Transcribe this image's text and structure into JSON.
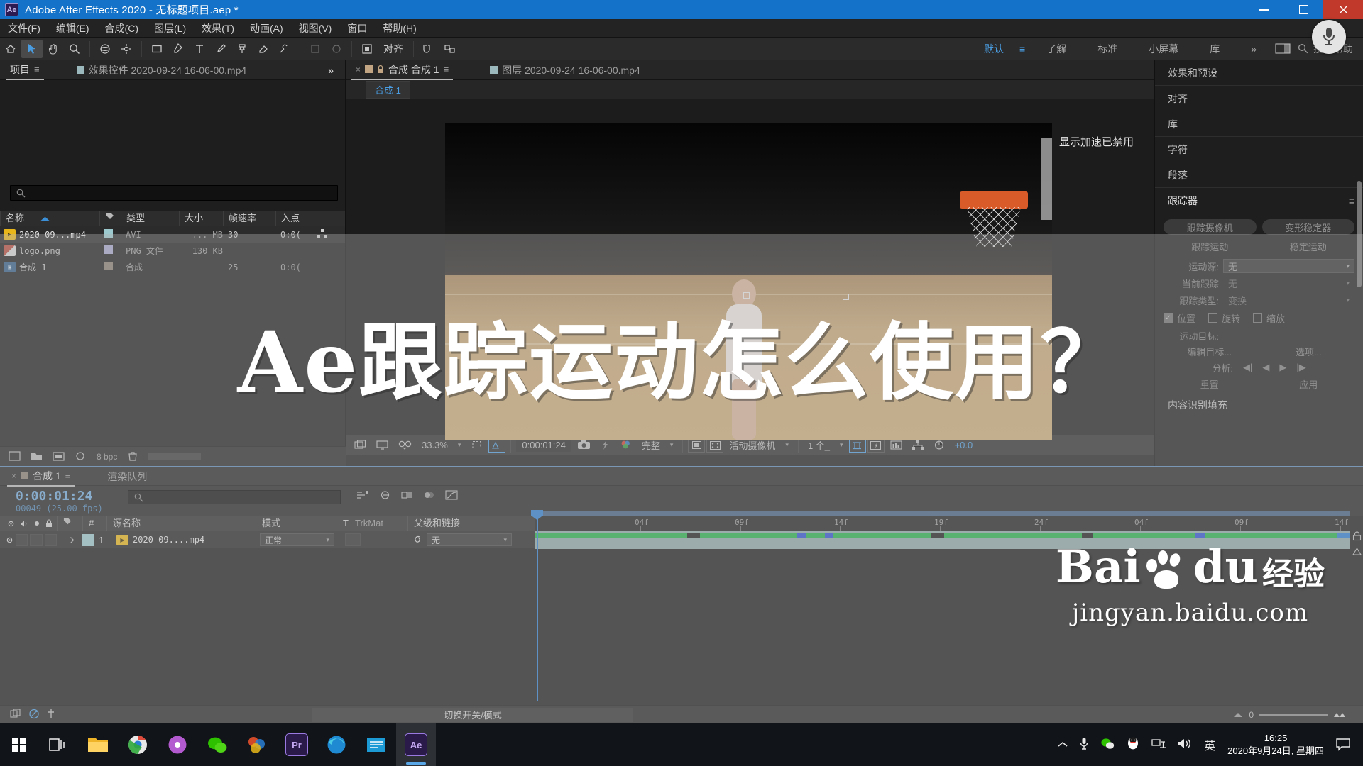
{
  "titlebar": {
    "app_badge": "Ae",
    "title": "Adobe After Effects 2020 - 无标题项目.aep *",
    "minimize": "minimize-icon",
    "maximize": "maximize-icon",
    "close": "close-icon"
  },
  "menubar": {
    "items": [
      {
        "label": "文件(F)"
      },
      {
        "label": "编辑(E)"
      },
      {
        "label": "合成(C)"
      },
      {
        "label": "图层(L)"
      },
      {
        "label": "效果(T)"
      },
      {
        "label": "动画(A)"
      },
      {
        "label": "视图(V)"
      },
      {
        "label": "窗口"
      },
      {
        "label": "帮助(H)"
      }
    ]
  },
  "toolbar": {
    "align_label": "对齐",
    "workspaces": [
      {
        "label": "默认",
        "active": true
      },
      {
        "label": "了解",
        "active": false
      },
      {
        "label": "标准",
        "active": false
      },
      {
        "label": "小屏幕",
        "active": false
      },
      {
        "label": "库",
        "active": false
      }
    ],
    "overflow": "»",
    "search_placeholder": "搜索帮助",
    "search_icon": "search-icon"
  },
  "project_panel": {
    "tabs": [
      {
        "label": "项目",
        "active": true,
        "menu": "≡"
      },
      {
        "label": "效果控件 2020-09-24 16-06-00.mp4",
        "active": false
      }
    ],
    "overflow": "»",
    "search_placeholder": "",
    "columns": [
      "名称",
      "类型",
      "大小",
      "帧速率",
      "入点"
    ],
    "sort_column": "名称",
    "rows": [
      {
        "name": "2020-09...mp4",
        "type": "AVI",
        "size": "... MB",
        "fps": "30",
        "in": "0:0(",
        "icon": "video-file-icon"
      },
      {
        "name": "logo.png",
        "type": "PNG 文件",
        "size": "130 KB",
        "fps": "",
        "in": "",
        "icon": "image-file-icon"
      },
      {
        "name": "合成 1",
        "type": "合成",
        "size": "",
        "fps": "25",
        "in": "0:0(",
        "icon": "composition-icon"
      }
    ]
  },
  "comp_panel": {
    "tabs": [
      {
        "label": "合成 合成 1",
        "active": true
      },
      {
        "label": "图层 2020-09-24 16-06-00.mp4",
        "active": false
      }
    ],
    "breadcrumb": "合成 1",
    "accel_notice": "显示加速已禁用",
    "footer": {
      "zoom": "33.3%",
      "timecode": "0:00:01:24",
      "resolution": "完整",
      "camera": "活动摄像机",
      "views": "1 个_",
      "exposure": "+0.0"
    }
  },
  "right_panel": {
    "rows": [
      {
        "label": "效果和预设"
      },
      {
        "label": "对齐"
      },
      {
        "label": "库"
      },
      {
        "label": "字符"
      },
      {
        "label": "段落"
      }
    ],
    "tracker": {
      "title": "跟踪器",
      "menu": "≡",
      "buttons": [
        {
          "label": "跟踪摄像机"
        },
        {
          "label": "变形稳定器"
        }
      ],
      "buttons2": [
        {
          "label": "跟踪运动"
        },
        {
          "label": "稳定运动"
        }
      ],
      "motion_source_label": "运动源:",
      "motion_source_value": "无",
      "current_track_label": "当前跟踪",
      "current_track_value": "无",
      "track_type_label": "跟踪类型:",
      "track_type_value": "变换",
      "checkboxes": [
        {
          "label": "位置",
          "checked": true
        },
        {
          "label": "旋转",
          "checked": false
        },
        {
          "label": "缩放",
          "checked": false
        }
      ],
      "motion_target_label": "运动目标:",
      "edit_target_label": "编辑目标...",
      "options_label": "选项...",
      "analyze_label": "分析:",
      "reset_label": "重置",
      "apply_label": "应用"
    },
    "footer_row": "内容识别填充"
  },
  "timeline": {
    "tabs": [
      {
        "label": "合成 1",
        "active": true
      },
      {
        "label": "渲染队列",
        "active": false
      }
    ],
    "timecode": "0:00:01:24",
    "frame_info": "00049 (25.00 fps)",
    "search_placeholder": "",
    "columns": [
      "#",
      "源名称",
      "模式",
      "T",
      "TrkMat",
      "父级和链接"
    ],
    "layers": [
      {
        "index": "1",
        "source_name": "2020-09....mp4",
        "mode": "正常",
        "trkmat": "",
        "parent": "无"
      }
    ],
    "ruler_ticks": [
      "04f",
      "09f",
      "14f",
      "19f",
      "24f",
      "04f",
      "09f",
      "14f"
    ],
    "status": {
      "toggle_label": "切换开关/模式",
      "zoom_value": "0"
    }
  },
  "overlay": {
    "title": "Ae跟踪运动怎么使用？",
    "watermark_brand": "Bai",
    "watermark_brand2": "du",
    "watermark_exp": "经验",
    "watermark_url": "jingyan.baidu.com"
  },
  "taskbar": {
    "start": "windows-start-icon",
    "apps": [
      {
        "name": "task-view-icon",
        "glyph": "⧉",
        "color": "#1b1f24",
        "active": false
      },
      {
        "name": "file-explorer-icon",
        "glyph": "📁",
        "color": "#f0b429",
        "active": false
      },
      {
        "name": "chrome-icon",
        "glyph": "◎",
        "color": "#e8e8e8",
        "active": false
      },
      {
        "name": "media-player-icon",
        "glyph": "◉",
        "color": "#b45ad0",
        "active": false
      },
      {
        "name": "wechat-icon",
        "glyph": "◍",
        "color": "#2dc100",
        "active": false
      },
      {
        "name": "photoshop-elements-icon",
        "glyph": "◈",
        "color": "#d04a2a",
        "active": false
      },
      {
        "name": "premiere-pro-icon",
        "glyph": "Pr",
        "color": "#2a1a4a",
        "active": false
      },
      {
        "name": "edge-icon",
        "glyph": "◐",
        "color": "#1f8ad2",
        "active": false
      },
      {
        "name": "text-editor-icon",
        "glyph": "▤",
        "color": "#1b9ad6",
        "active": false
      },
      {
        "name": "after-effects-icon",
        "glyph": "Ae",
        "color": "#2a1a4a",
        "active": true
      }
    ],
    "tray": {
      "expand": "chevron-up-icon",
      "mic": "microphone-icon",
      "wechat": "wechat-tray-icon",
      "qq": "qq-tray-icon",
      "network": "network-icon",
      "volume": "volume-icon",
      "ime": "英"
    },
    "time": "16:25",
    "date": "2020年9月24日, 星期四",
    "notifications": "notification-icon"
  }
}
